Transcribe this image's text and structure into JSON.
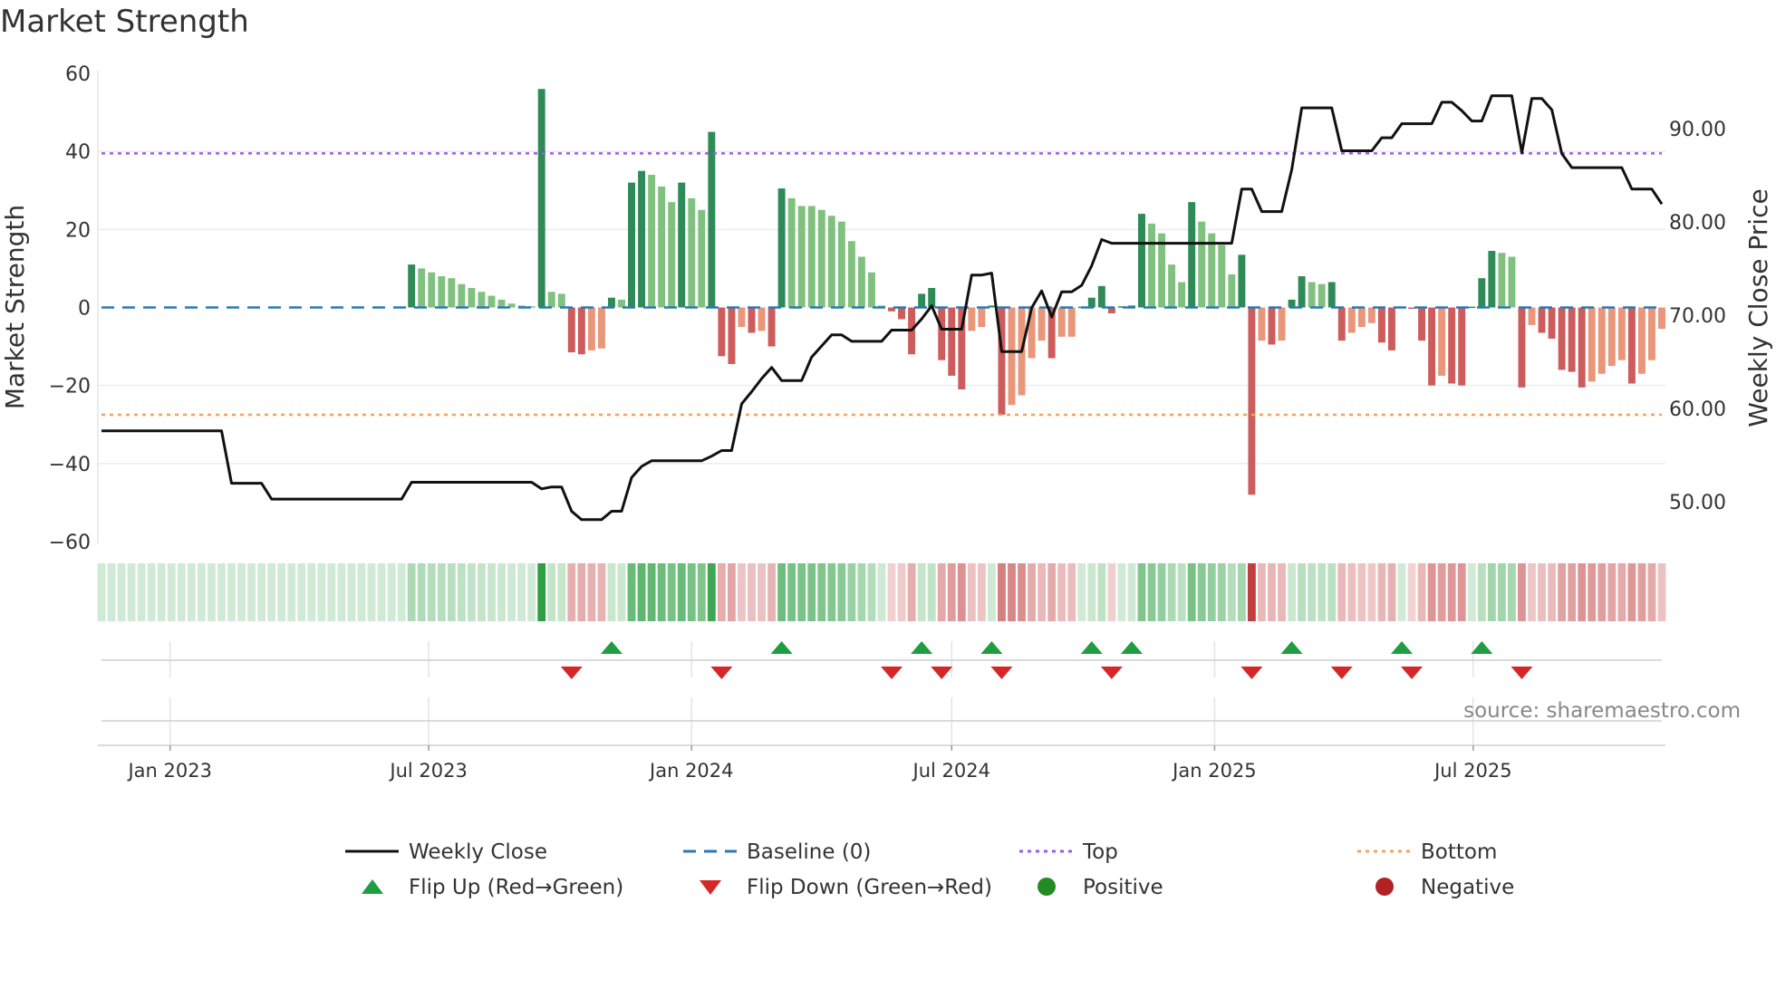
{
  "title": "Market Strength",
  "source": "source: sharemaestro.com",
  "colors": {
    "line": "#111111",
    "baseline": "#2a7ab0",
    "top": "#9b5de5",
    "bottom": "#f0a35e",
    "pos_dark": "#2e8b57",
    "pos_light": "#80c17f",
    "neg_dark": "#cd5c5c",
    "neg_light": "#e9967a",
    "flip_up": "#1e9e3e",
    "flip_down": "#d62728",
    "positive": "#228b22",
    "negative": "#b22222"
  },
  "chart_data": {
    "type": "bar",
    "title": "Market Strength",
    "ylabel": "Market Strength",
    "y2label": "Weekly Close Price",
    "ylim": [
      -60,
      60
    ],
    "y2lim": [
      45,
      95
    ],
    "yticks": [
      "60",
      "40",
      "20",
      "0",
      "−20",
      "−40",
      "−60"
    ],
    "ytick_values": [
      60,
      40,
      20,
      0,
      -20,
      -40,
      -60
    ],
    "y2ticks": [
      "90.00",
      "80.00",
      "70.00",
      "60.00",
      "50.00"
    ],
    "y2tick_values": [
      90,
      80,
      70,
      60,
      50
    ],
    "top_level": 39.5,
    "bottom_level": -27.5,
    "start_date": "2022-11-14",
    "interval_days": 7,
    "xticks": [
      {
        "label": "Jan 2023",
        "date": "2023-01-01"
      },
      {
        "label": "Jul 2023",
        "date": "2023-07-01"
      },
      {
        "label": "Jan 2024",
        "date": "2024-01-01"
      },
      {
        "label": "Jul 2024",
        "date": "2024-07-01"
      },
      {
        "label": "Jan 2025",
        "date": "2025-01-01"
      },
      {
        "label": "Jul 2025",
        "date": "2025-07-01"
      }
    ],
    "strength": [
      0,
      0,
      0,
      0,
      0,
      0,
      0,
      0,
      0,
      0,
      0,
      0,
      0,
      0,
      0,
      0,
      0,
      0,
      0,
      0,
      0,
      0,
      0,
      0,
      0,
      0,
      0,
      0,
      0,
      0,
      0,
      11,
      10,
      9,
      8,
      7.5,
      6,
      5,
      4,
      3,
      2,
      1,
      0.5,
      0.3,
      56,
      4,
      3.5,
      -11.5,
      -12,
      -11,
      -10.5,
      2.5,
      2,
      32,
      35,
      34,
      31,
      27,
      32,
      28,
      25,
      45,
      -12.5,
      -14.5,
      -5,
      -6.5,
      -6,
      -10,
      30.5,
      28,
      26,
      26,
      25,
      23.5,
      22,
      17,
      13,
      9,
      0.5,
      -1,
      -3,
      -12,
      3.5,
      5,
      -13.5,
      -17.5,
      -21,
      -6,
      -5,
      0.5,
      -27.5,
      -25,
      -22.5,
      -13,
      -8.5,
      -13,
      -7.5,
      -7.5,
      0.2,
      2.5,
      5.5,
      -1.5,
      0.3,
      0.5,
      24,
      21.5,
      19,
      11,
      6.5,
      27,
      22,
      19,
      16,
      8.5,
      13.5,
      -48,
      -8.5,
      -9.5,
      -8.5,
      2,
      8,
      6.5,
      6,
      6.5,
      -8.5,
      -6.5,
      -5,
      -4,
      -9,
      -11,
      0.2,
      -0.2,
      -8.5,
      -20,
      -17.5,
      -19.5,
      -20,
      0.2,
      7.5,
      14.5,
      14,
      13,
      -20.5,
      -4.5,
      -6.5,
      -8,
      -16,
      -16.5,
      -20.5,
      -19,
      -17,
      -15,
      -13.5,
      -19.5,
      -17,
      -13.5,
      -5.5
    ],
    "weekly_close": [
      57.6,
      57.6,
      57.6,
      57.6,
      57.6,
      57.6,
      57.6,
      57.6,
      57.6,
      57.6,
      57.6,
      57.6,
      57.6,
      52,
      52,
      52,
      52,
      50.3,
      50.3,
      50.3,
      50.3,
      50.3,
      50.3,
      50.3,
      50.3,
      50.3,
      50.3,
      50.3,
      50.3,
      50.3,
      50.3,
      52.1,
      52.1,
      52.1,
      52.1,
      52.1,
      52.1,
      52.1,
      52.1,
      52.1,
      52.1,
      52.1,
      52.1,
      52.1,
      51.4,
      51.6,
      51.6,
      49,
      48.1,
      48.1,
      48.1,
      49,
      49,
      52.6,
      53.8,
      54.4,
      54.4,
      54.4,
      54.4,
      54.4,
      54.4,
      54.9,
      55.5,
      55.5,
      60.5,
      61.8,
      63.2,
      64.4,
      63,
      63,
      63,
      65.5,
      66.7,
      67.9,
      67.9,
      67.2,
      67.2,
      67.2,
      67.2,
      68.4,
      68.4,
      68.4,
      69.6,
      71,
      68.5,
      68.5,
      68.5,
      74.3,
      74.3,
      74.5,
      66.1,
      66.1,
      66.1,
      70.8,
      72.6,
      69.8,
      72.5,
      72.5,
      73.2,
      75.3,
      78.1,
      77.7,
      77.7,
      77.7,
      77.7,
      77.7,
      77.7,
      77.7,
      77.7,
      77.7,
      77.7,
      77.7,
      77.7,
      77.7,
      83.5,
      83.5,
      81.1,
      81.1,
      81.1,
      85.6,
      92.2,
      92.2,
      92.2,
      92.2,
      87.6,
      87.6,
      87.6,
      87.6,
      89,
      89,
      90.5,
      90.5,
      90.5,
      90.5,
      92.8,
      92.8,
      91.9,
      90.8,
      90.8,
      93.5,
      93.5,
      93.5,
      87.4,
      93.2,
      93.2,
      92,
      87.3,
      85.8,
      85.8,
      85.8,
      85.8,
      85.8,
      85.8,
      83.5,
      83.5,
      83.5,
      81.9
    ],
    "flip_up_weeks": [
      51,
      68,
      82,
      89,
      99,
      103,
      119,
      130,
      138
    ],
    "flip_down_weeks": [
      47,
      62,
      79,
      84,
      90,
      101,
      115,
      124,
      131,
      142
    ],
    "legend_placement": "bottom",
    "legend": [
      {
        "label": "Weekly Close",
        "kind": "line-solid",
        "color_key": "line"
      },
      {
        "label": "Baseline (0)",
        "kind": "line-dash",
        "color_key": "baseline"
      },
      {
        "label": "Top",
        "kind": "line-dot",
        "color_key": "top"
      },
      {
        "label": "Bottom",
        "kind": "line-dot",
        "color_key": "bottom"
      },
      {
        "label": "Flip Up (Red→Green)",
        "kind": "tri-up",
        "color_key": "flip_up"
      },
      {
        "label": "Flip Down (Green→Red)",
        "kind": "tri-down",
        "color_key": "flip_down"
      },
      {
        "label": "Positive",
        "kind": "dot",
        "color_key": "positive"
      },
      {
        "label": "Negative",
        "kind": "dot",
        "color_key": "negative"
      }
    ]
  }
}
